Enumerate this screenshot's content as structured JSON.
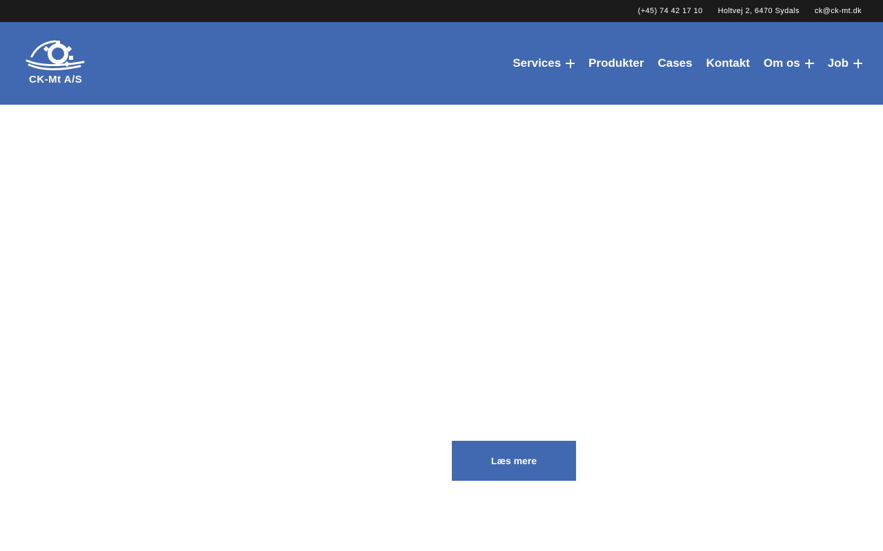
{
  "topbar": {
    "phone": "(+45) 74 42 17 10",
    "address": "Holtvej 2, 6470 Sydals",
    "email": "ck@ck-mt.dk"
  },
  "header": {
    "logo_text": "CK-Mt A/S",
    "nav": [
      {
        "label": "Services",
        "has_submenu": true
      },
      {
        "label": "Produkter",
        "has_submenu": false
      },
      {
        "label": "Cases",
        "has_submenu": false
      },
      {
        "label": "Kontakt",
        "has_submenu": false
      },
      {
        "label": "Om os",
        "has_submenu": true
      },
      {
        "label": "Job",
        "has_submenu": true
      }
    ]
  },
  "main": {
    "cta_label": "Læs mere"
  },
  "colors": {
    "brand_blue": "#4169b2",
    "topbar_bg": "#1b1b1b",
    "page_bg": "#ffffff"
  }
}
